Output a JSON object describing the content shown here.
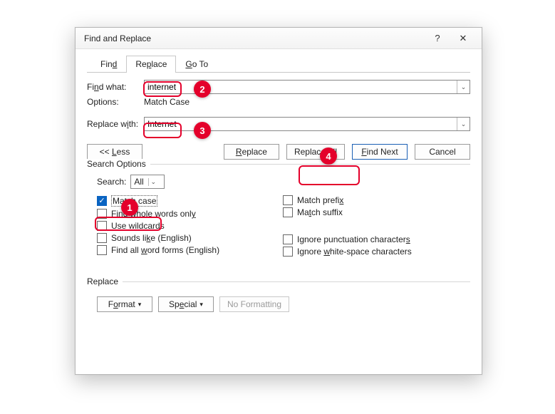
{
  "title": "Find and Replace",
  "titlebar": {
    "help": "?",
    "close": "✕"
  },
  "tabs": {
    "find": "Find",
    "replace": "Replace",
    "goto": "Go To"
  },
  "find": {
    "label_pre": "Fi",
    "label_ul": "n",
    "label_post": "d what:",
    "value": "internet",
    "options_label": "Options:",
    "options_value": "Match Case"
  },
  "replace": {
    "label_pre": "Replace w",
    "label_ul": "i",
    "label_post": "th:",
    "value": "Internet"
  },
  "buttons": {
    "less": "<< Less",
    "less_ul": "L",
    "replace_pre": "",
    "replace_ul": "R",
    "replace_post": "eplace",
    "replaceall_pre": "Replace ",
    "replaceall_ul": "A",
    "replaceall_post": "ll",
    "findnext_pre": "",
    "findnext_ul": "F",
    "findnext_post": "ind Next",
    "cancel": "Cancel"
  },
  "search_options": {
    "legend": "Search Options",
    "search_label": "Search:",
    "search_value": "All",
    "left": [
      {
        "checked": true,
        "pre": "Matc",
        "ul": "h",
        "post": " case",
        "focus": true
      },
      {
        "checked": false,
        "pre": "Find whole words onl",
        "ul": "y",
        "post": ""
      },
      {
        "checked": false,
        "pre": "",
        "ul": "U",
        "post": "se wildcards"
      },
      {
        "checked": false,
        "pre": "Sounds li",
        "ul": "k",
        "post": "e (English)"
      },
      {
        "checked": false,
        "pre": "Find all ",
        "ul": "w",
        "post": "ord forms (English)"
      }
    ],
    "right": [
      {
        "checked": false,
        "pre": "Match prefi",
        "ul": "x",
        "post": ""
      },
      {
        "checked": false,
        "pre": "Ma",
        "ul": "t",
        "post": "ch suffix"
      },
      null,
      {
        "checked": false,
        "pre": "Ignore punctuation character",
        "ul": "s",
        "post": ""
      },
      {
        "checked": false,
        "pre": "Ignore ",
        "ul": "w",
        "post": "hite-space characters"
      }
    ]
  },
  "replace_section": {
    "legend": "Replace",
    "format_pre": "F",
    "format_ul": "o",
    "format_post": "rmat",
    "special_pre": "Sp",
    "special_ul": "e",
    "special_post": "cial",
    "noformat": "No Formatting"
  },
  "callouts": {
    "c1": "1",
    "c2": "2",
    "c3": "3",
    "c4": "4"
  }
}
